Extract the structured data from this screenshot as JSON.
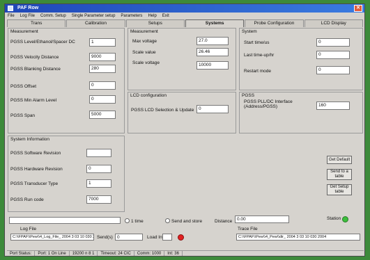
{
  "window": {
    "title": "PAF Row"
  },
  "menu": [
    "File",
    "Log File",
    "Comm. Setup",
    "Single Parameter setup",
    "Parameters",
    "Help",
    "Exit"
  ],
  "tabs": [
    "Trans",
    "Calibration",
    "Setups",
    "Systems",
    "Probe Configuration",
    "LCD Display"
  ],
  "measurement_panel": {
    "title": "Measurement",
    "rows": [
      {
        "label": "PGSS Level/Ethanol/Spacer DC",
        "value": "1"
      },
      {
        "label": "PGSS Velocity Distance",
        "value": "9000"
      },
      {
        "label": "PGSS Blanking Distance",
        "value": "280"
      },
      {
        "label": "PGSS Offset",
        "value": "0"
      },
      {
        "label": "PGSS Min Alarm Level",
        "value": "0"
      },
      {
        "label": "PGSS Span",
        "value": "5000"
      }
    ]
  },
  "sensor_panel": {
    "title": "Measurement",
    "rows": [
      {
        "label": "Max voltage",
        "value": "27.0"
      },
      {
        "label": "Scale value",
        "value": "26.46"
      },
      {
        "label": "Scale voltage",
        "value": "10000"
      }
    ]
  },
  "lcd_panel": {
    "title": "LCD configuration",
    "row": {
      "label": "PGSS LCD Selection & Update",
      "value": "0"
    }
  },
  "system_panel": {
    "title": "System",
    "rows": [
      {
        "label": "Start time/us",
        "value": "0"
      },
      {
        "label": "Last time-up/hr",
        "value": "0"
      },
      {
        "label": "Restart mode",
        "value": "0"
      }
    ]
  },
  "pgss_panel": {
    "title": "PGSS",
    "row": {
      "label": "PGSS PLL/DC Interface (Address/PGSS)",
      "value": "160"
    }
  },
  "sysinfo_panel": {
    "title": "System Information",
    "rows": [
      {
        "label": "PGSS Software Revision",
        "value": ""
      },
      {
        "label": "PGSS Hardware Revision",
        "value": "0"
      },
      {
        "label": "PGSS Transducer Type",
        "value": "1"
      },
      {
        "label": "PGSS Run code",
        "value": "7000"
      }
    ]
  },
  "right_buttons": [
    "Get Default",
    "Send to a table",
    "Get Setup table"
  ],
  "bottom": {
    "progress_value": "",
    "radio1_label": "1 time",
    "radio2_label": "Send and store",
    "distance_label": "Distance",
    "distance_value": "0.00",
    "station_label": "Station",
    "logfile_label": "Log File",
    "logfile_value": "C:\\\\FPAF\\\\Pew\\\\4_Log_File_ 2004 3 03 10 030 2.csv",
    "send_label": "Send(s)",
    "send_value": "0",
    "load_label": "Load Int",
    "tracefile_label": "Trace File",
    "tracefile_value": "C:\\\\FPAF\\\\Pew\\\\4_Pew\\\\dir_ 2004 3 03 10 030 2004"
  },
  "statusbar": [
    "Port Status:",
    "Port: 1 On Line",
    "19200 n 8 1",
    "Timeout: 24 CIC",
    "Comm: 1000",
    "Int: 36"
  ],
  "colors": {
    "title_bar": "#1f47b8",
    "indicator_red": "#e02020",
    "indicator_green": "#3cbf3c",
    "background": "#3d8a3a"
  }
}
